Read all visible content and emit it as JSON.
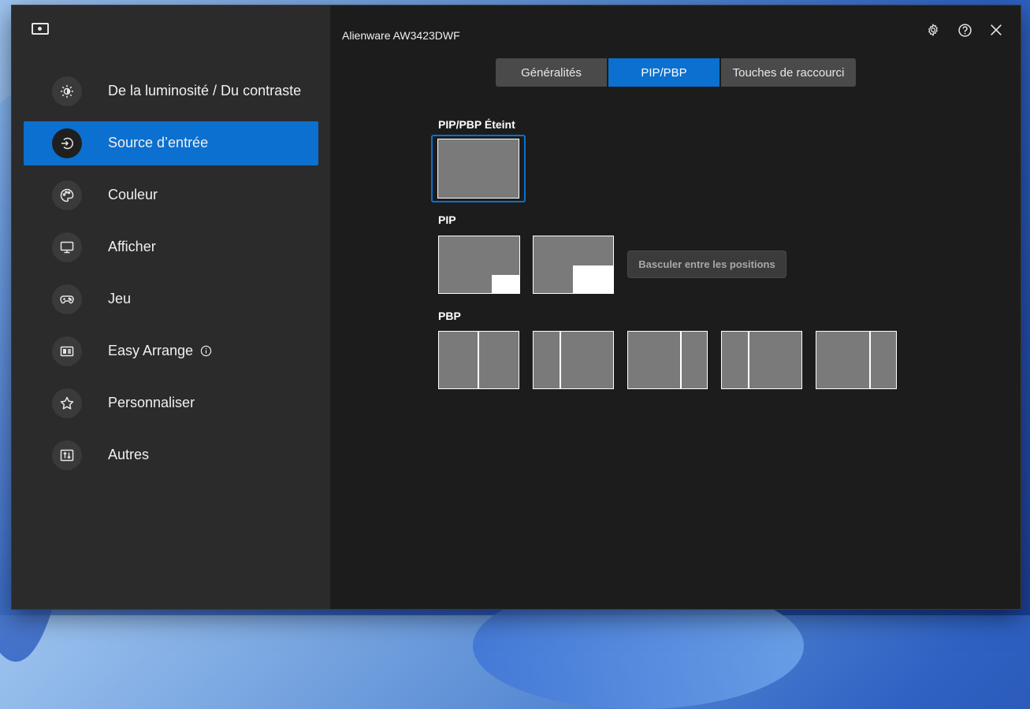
{
  "app": {
    "monitor_name": "Alienware AW3423DWF",
    "settings_icon": "gear-icon",
    "help_icon": "help-icon",
    "close_icon": "close-icon"
  },
  "sidebar": {
    "items": [
      {
        "label": "De la luminosité / Du contraste",
        "icon": "brightness-icon",
        "active": false
      },
      {
        "label": "Source d’entrée",
        "icon": "input-source-icon",
        "active": true
      },
      {
        "label": "Couleur",
        "icon": "palette-icon",
        "active": false
      },
      {
        "label": "Afficher",
        "icon": "monitor-icon",
        "active": false
      },
      {
        "label": "Jeu",
        "icon": "gamepad-icon",
        "active": false
      },
      {
        "label": "Easy Arrange",
        "icon": "easy-arrange-icon",
        "active": false,
        "has_info": true
      },
      {
        "label": "Personnaliser",
        "icon": "star-icon",
        "active": false
      },
      {
        "label": "Autres",
        "icon": "others-icon",
        "active": false
      }
    ]
  },
  "tabs": [
    {
      "label": "Généralités",
      "active": false
    },
    {
      "label": "PIP/PBP",
      "active": true
    },
    {
      "label": "Touches de raccourci",
      "active": false
    }
  ],
  "sections": {
    "off": {
      "title": "PIP/PBP Éteint"
    },
    "pip": {
      "title": "PIP",
      "switch_label": "Basculer entre les positions"
    },
    "pbp": {
      "title": "PBP"
    }
  },
  "colors": {
    "accent": "#0b70cf",
    "sidebar_bg": "#2b2b2b",
    "main_bg": "#1c1c1c",
    "tab_bg": "#4a4a4a",
    "layout_fill": "#7a7a7a"
  }
}
